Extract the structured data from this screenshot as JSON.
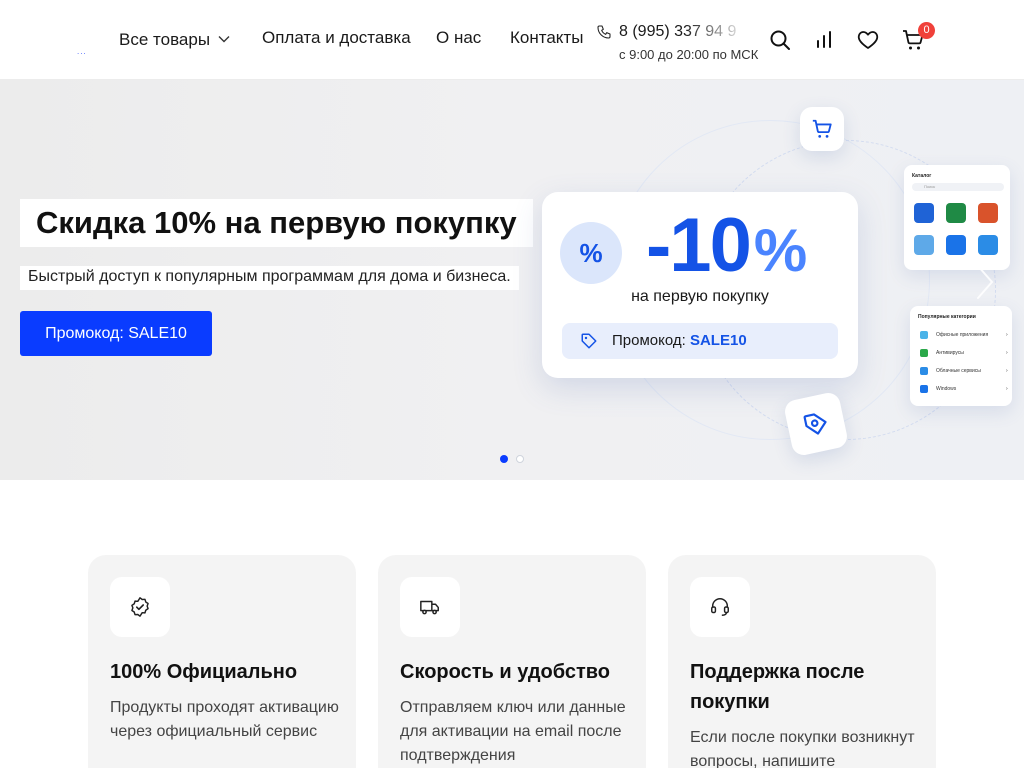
{
  "header": {
    "logo": "...",
    "nav": [
      {
        "label": "Все товары",
        "has_dropdown": true
      },
      {
        "label": "Оплата и доставка"
      },
      {
        "label": "О нас"
      },
      {
        "label": "Контакты"
      }
    ],
    "phone": "8 (995) 337 94 9",
    "hours": "с 9:00 до 20:00 по МСК",
    "icons": [
      "search-icon",
      "compare-icon",
      "heart-icon",
      "cart-icon"
    ],
    "cart_count": "0"
  },
  "hero": {
    "title": "Скидка 10% на первую покупку",
    "subtitle": "Быстрый доступ к популярным программам для дома и бизнеса.",
    "button": "Промокод: SALE10",
    "card": {
      "badge": "%",
      "discount": "-10",
      "discount_suffix": "%",
      "caption": "на первую покупку",
      "code_label": "Промокод:",
      "code": "SALE10"
    },
    "catalog_panel": {
      "title": "Каталог",
      "search": "Поиск"
    },
    "categories_panel": {
      "title": "Популярные категории",
      "items": [
        "Офисные приложения",
        "Антивирусы",
        "Облачные сервисы",
        "Windows"
      ]
    },
    "slides_total": 2,
    "active_slide": 1
  },
  "features": [
    {
      "icon": "badge-check-icon",
      "title": "100% Официально",
      "text": "Продукты проходят активацию через официальный сервис"
    },
    {
      "icon": "truck-icon",
      "title": "Скорость и удобство",
      "text": "Отправляем ключ или данные для активации на email после подтверждения"
    },
    {
      "icon": "headset-icon",
      "title": "Поддержка после покупки",
      "text": "Если после покупки возникнут вопросы, напишите"
    }
  ],
  "colors": {
    "accent": "#0a3cff",
    "promo_blue": "#1453e6",
    "badge_red": "#f0413a",
    "feature_bg": "#f4f4f4"
  }
}
